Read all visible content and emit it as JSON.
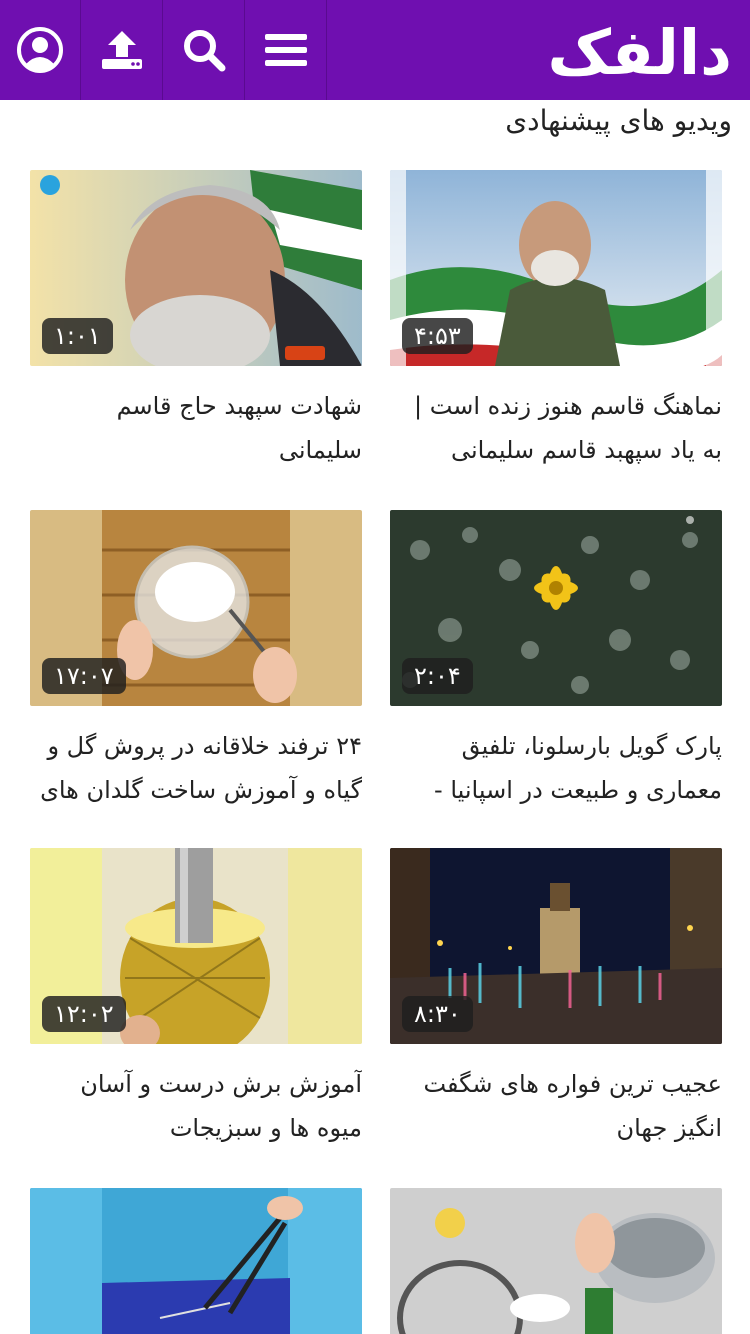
{
  "header": {
    "logo_text": "دالفک",
    "menu_icon": "hamburger-menu-icon",
    "search_icon": "search-icon",
    "upload_icon": "upload-icon",
    "profile_icon": "user-profile-icon",
    "bg_color": "#6f0fb0"
  },
  "section": {
    "title": "ویدیو های پیشنهادی"
  },
  "videos": [
    {
      "title": "نماهنگ قاسم هنوز زنده است | به یاد سپهبد قاسم سلیمانی",
      "duration": "۴:۵۳"
    },
    {
      "title": "شهادت سپهبد حاج قاسم سلیمانی",
      "duration": "۱:۰۱"
    },
    {
      "title": "پارک گویل بارسلونا، تلفیق معماری و طبیعت در اسپانیا -",
      "duration": "۲:۰۴"
    },
    {
      "title": "۲۴ ترفند خلاقانه در پروش گل و گیاه و آموزش ساخت گلدان های",
      "duration": "۱۷:۰۷"
    },
    {
      "title": "عجیب ترین فواره های شگفت انگیز جهان",
      "duration": "۸:۳۰"
    },
    {
      "title": "آموزش برش درست و آسان میوه ها و سبزیجات",
      "duration": "۱۲:۰۲"
    },
    {
      "title": "",
      "duration": ""
    },
    {
      "title": "",
      "duration": ""
    }
  ]
}
